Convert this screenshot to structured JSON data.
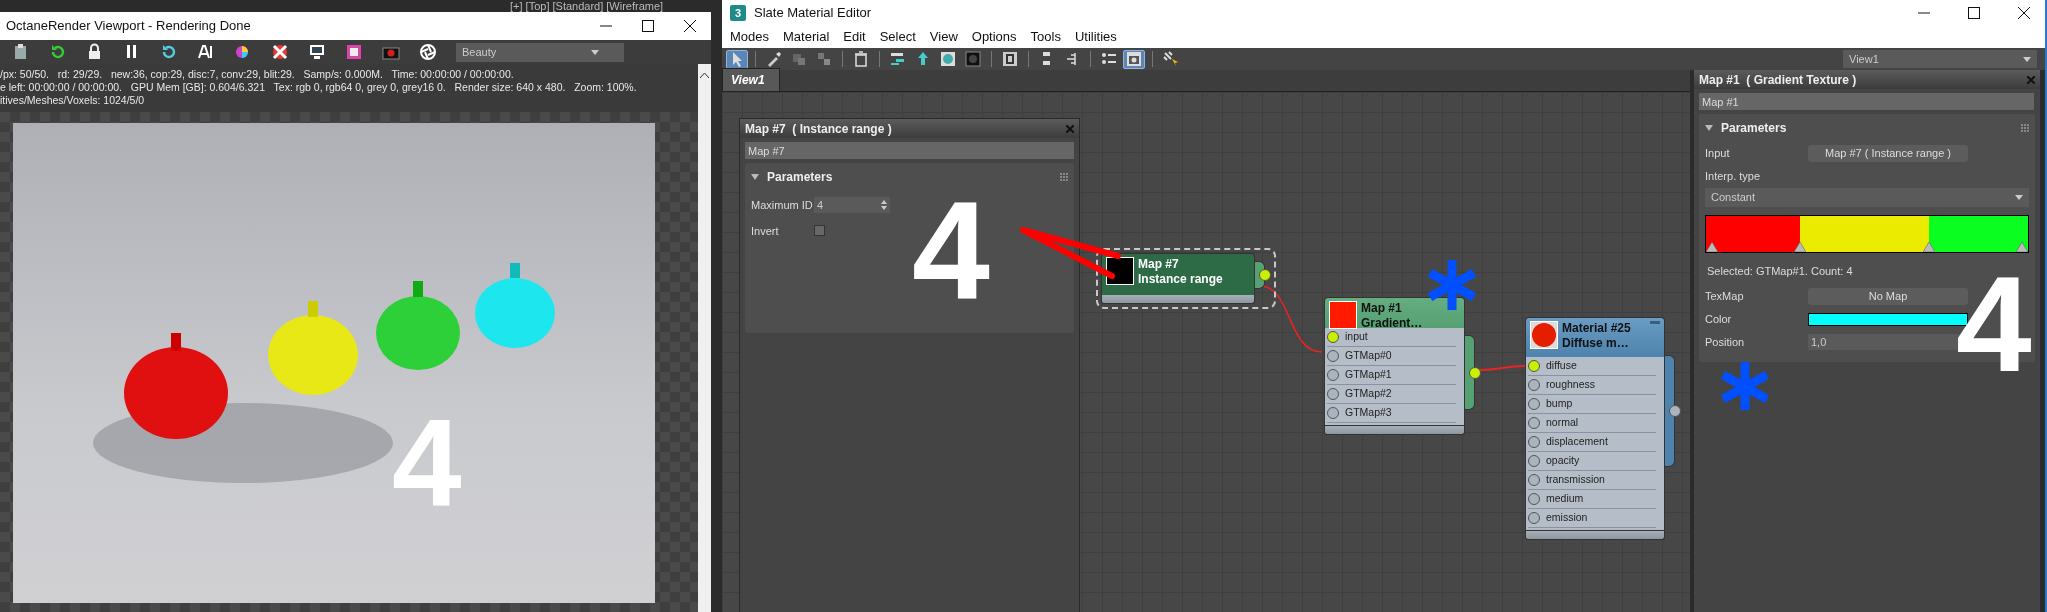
{
  "desktop_viewport": {
    "label": "[+] [Top] [Standard] [Wireframe]"
  },
  "octane_window": {
    "title": "OctaneRender Viewport - Rendering Done",
    "pass": "Beauty",
    "stats": [
      "/px: 50/50.   rd: 29/29.   new:36, cop:29, disc:7, conv:29, blit:29.   Samp/s: 0.000M.   Time: 00:00:00 / 00:00:00.",
      "e left: 00:00:00 / 00:00:00.   GPU Mem [GB]: 0.604/6.321   Tex: rgb 0, rgb64 0, grey 0, grey16 0.   Render size: 640 x 480.   Zoom: 100%.",
      "itives/Meshes/Voxels: 1024/5/0"
    ],
    "overlay_number": "4"
  },
  "slate_editor": {
    "logo": "3",
    "title": "Slate Material Editor",
    "menu": [
      "Modes",
      "Material",
      "Edit",
      "Select",
      "View",
      "Options",
      "Tools",
      "Utilities"
    ],
    "tools": [
      {
        "kind": "pointer",
        "active": true
      },
      {
        "kind": "eyedropper",
        "active": false
      },
      {
        "kind": "assign",
        "active": false
      },
      {
        "kind": "pick",
        "active": false
      },
      {
        "kind": "delete",
        "active": false
      },
      {
        "kind": "layout",
        "active": false
      },
      {
        "kind": "move",
        "active": false
      },
      {
        "kind": "background",
        "active": false
      },
      {
        "kind": "checker",
        "active": false
      },
      {
        "kind": "zero",
        "active": false
      },
      {
        "kind": "arrange",
        "active": false
      },
      {
        "kind": "tree",
        "active": false
      },
      {
        "kind": "list",
        "active": false
      },
      {
        "kind": "navigator",
        "active": true
      },
      {
        "kind": "matte",
        "active": false
      }
    ],
    "view_select": "View1",
    "tabs": [
      {
        "label": "View1",
        "selected": true
      }
    ],
    "param_window": {
      "title": "Map #7  ( Instance range )",
      "name": "Map #7",
      "rollout": "Parameters",
      "expanded": true,
      "fields": [
        {
          "kind": "spinner",
          "label": "Maximum ID",
          "value": "4"
        },
        {
          "kind": "checkbox",
          "label": "Invert",
          "checked": false
        }
      ]
    },
    "nodes": [
      {
        "kind": "map",
        "title": "Map #7",
        "subtitle": "Instance range",
        "selected": true,
        "color": "#000000",
        "output_connected": true
      },
      {
        "kind": "map",
        "title": "Map #1",
        "subtitle": "Gradient…",
        "selected": false,
        "color": "#ff1a00",
        "ports": [
          {
            "label": "input",
            "connected": true
          },
          {
            "label": "GTMap#0",
            "connected": false
          },
          {
            "label": "GTMap#1",
            "connected": false
          },
          {
            "label": "GTMap#2",
            "connected": false
          },
          {
            "label": "GTMap#3",
            "connected": false
          }
        ],
        "output_connected": true
      },
      {
        "kind": "material",
        "title": "Material #25",
        "subtitle": "Diffuse m…",
        "selected": false,
        "color": "#e61e00",
        "ports": [
          {
            "label": "diffuse",
            "connected": true
          },
          {
            "label": "roughness",
            "connected": false
          },
          {
            "label": "bump",
            "connected": false
          },
          {
            "label": "normal",
            "connected": false
          },
          {
            "label": "displacement",
            "connected": false
          },
          {
            "label": "opacity",
            "connected": false
          },
          {
            "label": "transmission",
            "connected": false
          },
          {
            "label": "medium",
            "connected": false
          },
          {
            "label": "emission",
            "connected": false
          }
        ],
        "output_connected": false
      }
    ],
    "overlay_number": "4"
  },
  "inspector": {
    "title": "Map #1  ( Gradient Texture )",
    "name": "Map #1",
    "rollout": "Parameters",
    "expanded": true,
    "input_label": "Input",
    "input_value": "Map #7  ( Instance range )",
    "interp_label": "Interp. type",
    "interp_value": "Constant",
    "flags": [
      {
        "level": 0
      },
      {
        "level": 0.285
      },
      {
        "level": 0.7
      },
      {
        "level": 1
      }
    ],
    "segments": [
      {
        "color": "#ff0000"
      },
      {
        "color": "#ebeb00"
      },
      {
        "color": "#0aff20"
      }
    ],
    "selection_text": "Selected: GTMap#1. Count: 4",
    "texmap_label": "TexMap",
    "texmap_value": "No Map",
    "color_label": "Color",
    "color": "#00ffff",
    "position_label": "Position",
    "position_value": "1,0",
    "overlay_number": "4"
  }
}
